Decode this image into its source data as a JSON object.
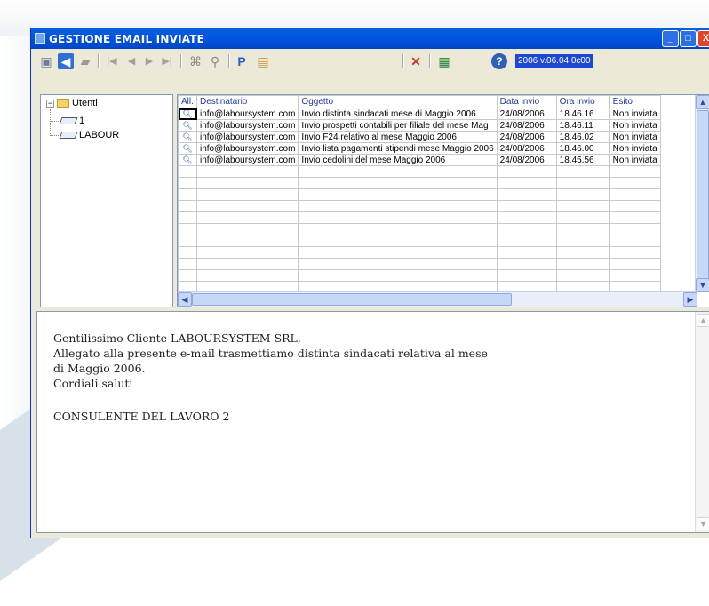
{
  "window": {
    "title": "GESTIONE EMAIL INVIATE",
    "controls": {
      "minimize": "_",
      "maximize": "□",
      "close": "X"
    }
  },
  "toolbar": {
    "icons": [
      "save-icon",
      "back-icon",
      "folder-icon",
      "first-record-icon",
      "prev-record-icon",
      "next-record-icon",
      "last-record-icon",
      "binoculars-icon",
      "search-icon",
      "edit-icon",
      "image-icon",
      "delete-icon",
      "excel-icon",
      "help-icon"
    ],
    "version": "2006 v.06.04.0c00"
  },
  "tree": {
    "root": "Utenti",
    "children": [
      "1",
      "LABOUR"
    ]
  },
  "grid": {
    "columns": [
      "All.",
      "Destinatario",
      "Oggetto",
      "Data invio",
      "Ora invio",
      "Esito"
    ],
    "rows": [
      {
        "dest": "info@laboursystem.com",
        "oggetto": "Invio distinta sindacati mese di Maggio 2006",
        "data": "24/08/2006",
        "ora": "18.46.16",
        "esito": "Non inviata"
      },
      {
        "dest": "info@laboursystem.com",
        "oggetto": "Invio prospetti contabili per filiale del mese Mag",
        "data": "24/08/2006",
        "ora": "18.46.11",
        "esito": "Non inviata"
      },
      {
        "dest": "info@laboursystem.com",
        "oggetto": "Invio F24 relativo al mese Maggio 2006",
        "data": "24/08/2006",
        "ora": "18.46.02",
        "esito": "Non inviata"
      },
      {
        "dest": "info@laboursystem.com",
        "oggetto": "Invio lista pagamenti stipendi mese Maggio 2006",
        "data": "24/08/2006",
        "ora": "18.46.00",
        "esito": "Non inviata"
      },
      {
        "dest": "info@laboursystem.com",
        "oggetto": "Invio cedolini del mese Maggio 2006",
        "data": "24/08/2006",
        "ora": "18.45.56",
        "esito": "Non inviata"
      }
    ],
    "empty_rows": 11
  },
  "message": {
    "lines": [
      "Gentilissimo Cliente LABOURSYSTEM SRL,",
      "Allegato alla presente e-mail trasmettiamo distinta sindacati relativa al mese",
      "di Maggio 2006.",
      "Cordiali saluti",
      "",
      "CONSULENTE DEL LAVORO 2"
    ]
  },
  "colors": {
    "titlebar": "#0054e3",
    "header_text": "#1f3a9e",
    "window_face": "#ece9d8",
    "version_bg": "#1c48d6"
  }
}
